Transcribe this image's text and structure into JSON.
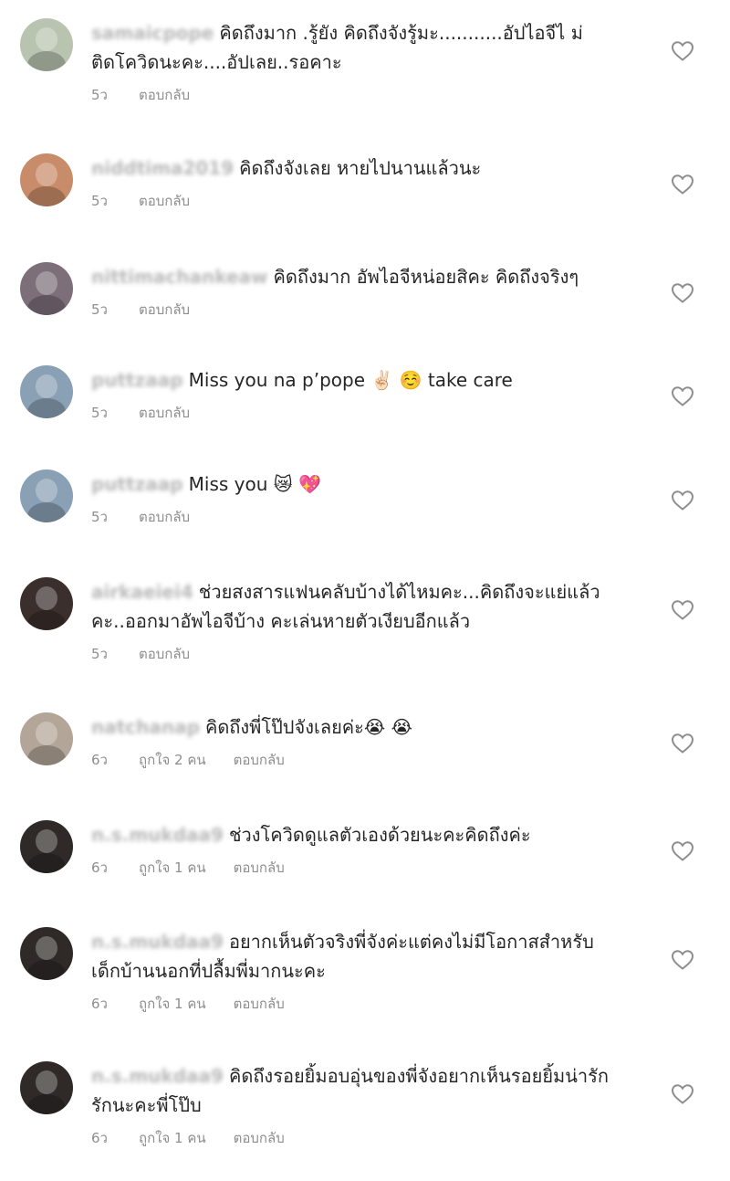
{
  "comments": [
    {
      "username": "samaicpope",
      "lines": [
        "คิดถึงมาก .รู้ยัง  คิดถึงจังรู้มะ...........อัปไอจีไ ม่ ",
        "ติดโควิดนะคะ....อัปเลย..รอคาะ"
      ],
      "time": "5ว",
      "likes": "",
      "reply": "ตอบกลับ",
      "avatar_color": "#b9c4b0"
    },
    {
      "username": "niddtima2019",
      "lines": [
        "คิดถึงจังเลย หายไปนานแล้วนะ"
      ],
      "time": "5ว",
      "likes": "",
      "reply": "ตอบกลับ",
      "avatar_color": "#c98c6a"
    },
    {
      "username": "nittimachankeaw",
      "lines": [
        "คิดถึงมาก อัพไอจีหน่อยสิคะ คิดถึงจริงๆ"
      ],
      "time": "5ว",
      "likes": "",
      "reply": "ตอบกลับ",
      "avatar_color": "#7d6f7a"
    },
    {
      "username": "puttzaap",
      "lines": [
        "Miss you na p’pope ✌🏻 ☺️ take care"
      ],
      "time": "5ว",
      "likes": "",
      "reply": "ตอบกลับ",
      "avatar_color": "#8aa0b5"
    },
    {
      "username": "puttzaap",
      "lines": [
        "Miss you 😿 💖"
      ],
      "time": "5ว",
      "likes": "",
      "reply": "ตอบกลับ",
      "avatar_color": "#8aa0b5"
    },
    {
      "username": "airkaeiei4",
      "lines": [
        "ช่วยสงสารแฟนคลับบ้างได้ไหมคะ...คิดถึงจะแย่แล้ว",
        "คะ..ออกมาอัพไอจีบ้าง คะเล่นหายตัวเงียบอีกแล้ว"
      ],
      "time": "5ว",
      "likes": "",
      "reply": "ตอบกลับ",
      "avatar_color": "#3a2f2c"
    },
    {
      "username": "natchanap",
      "lines": [
        "คิดถึงพี่โป๊ปจังเลยค่ะ😭 😭"
      ],
      "time": "6ว",
      "likes": "ถูกใจ 2 คน",
      "reply": "ตอบกลับ",
      "avatar_color": "#b3a598"
    },
    {
      "username": "n.s.mukdaa9",
      "lines": [
        "ช่วงโควิดดูแลตัวเองด้วยนะคะคิดถึงค่ะ"
      ],
      "time": "6ว",
      "likes": "ถูกใจ 1 คน",
      "reply": "ตอบกลับ",
      "avatar_color": "#2f2a28"
    },
    {
      "username": "n.s.mukdaa9",
      "lines": [
        "อยากเห็นตัวจริงพี่จังค่ะแต่คงไม่มีโอกาสสำหรับ",
        "เด็กบ้านนอกที่ปลื้มพี่มากนะคะ"
      ],
      "time": "6ว",
      "likes": "ถูกใจ 1 คน",
      "reply": "ตอบกลับ",
      "avatar_color": "#2f2a28"
    },
    {
      "username": "n.s.mukdaa9",
      "lines": [
        "คิดถึงรอยยิ้มอบอุ่นของพี่จังอยากเห็นรอยยิ้มน่ารัก",
        "รักนะคะพี่โป๊บ"
      ],
      "time": "6ว",
      "likes": "ถูกใจ 1 คน",
      "reply": "ตอบกลับ",
      "avatar_color": "#2f2a28"
    }
  ]
}
